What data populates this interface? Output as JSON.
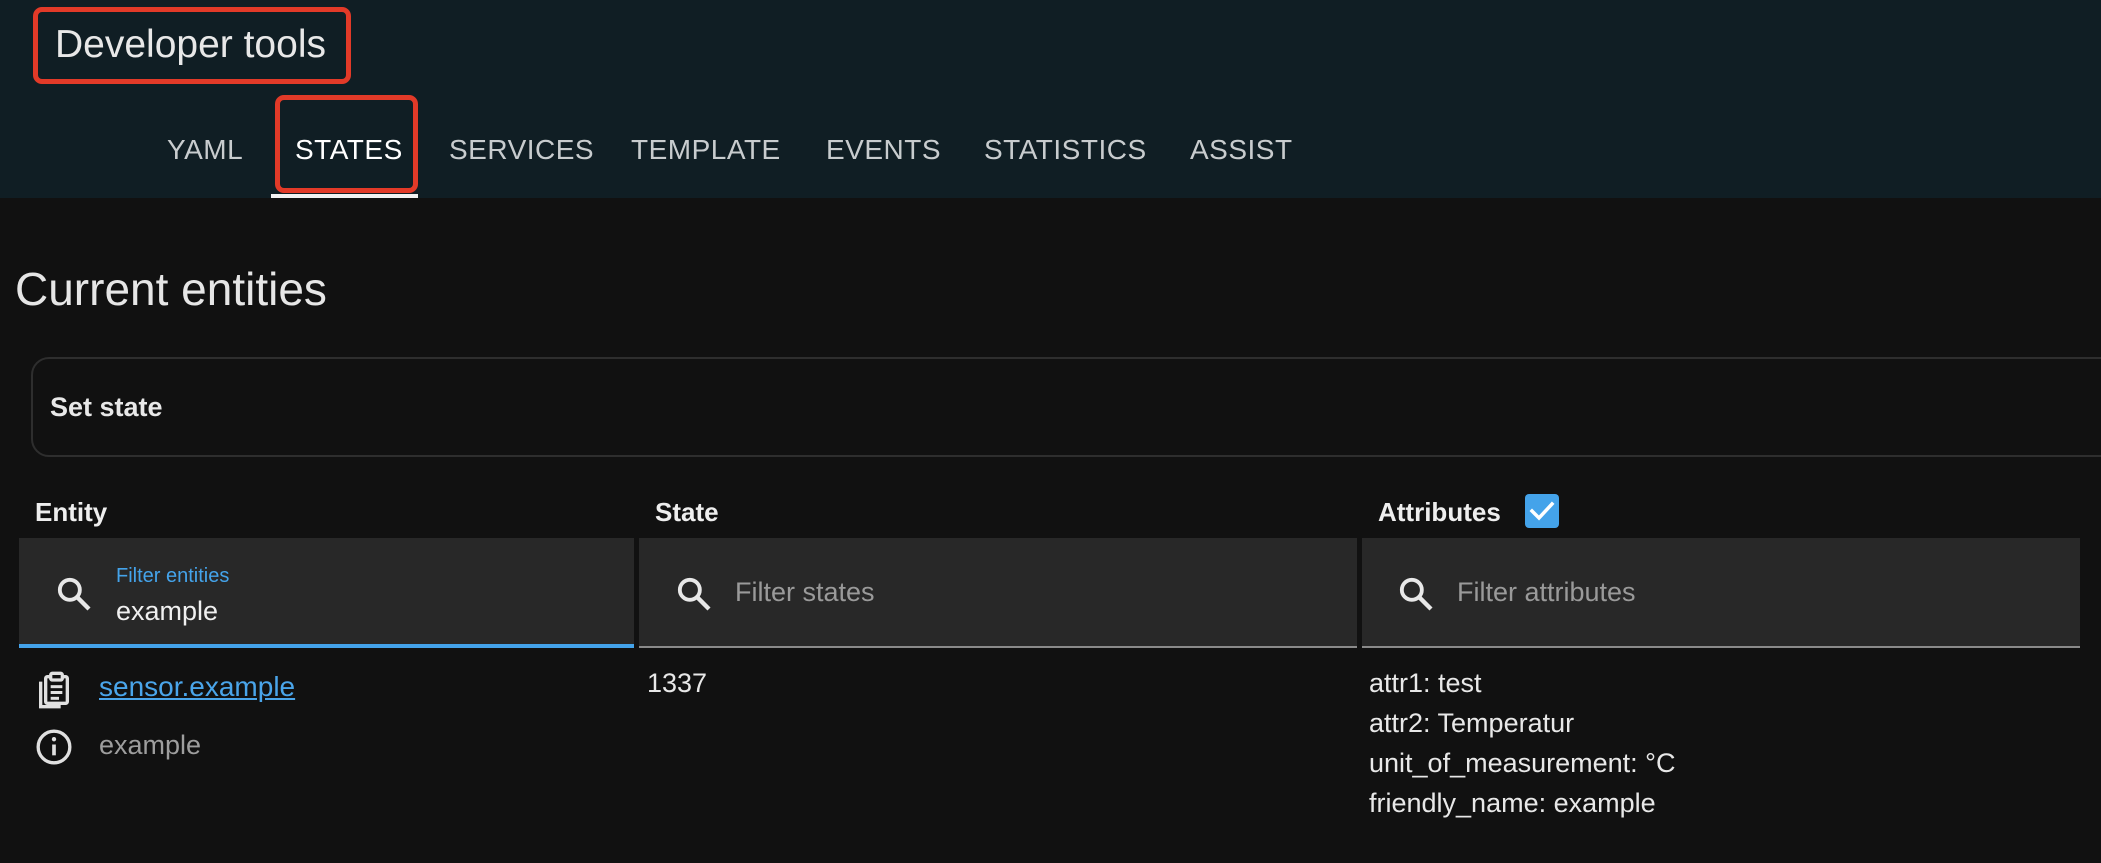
{
  "app": {
    "title": "Developer tools"
  },
  "tabs": [
    {
      "label": "YAML",
      "active": false
    },
    {
      "label": "STATES",
      "active": true
    },
    {
      "label": "SERVICES",
      "active": false
    },
    {
      "label": "TEMPLATE",
      "active": false
    },
    {
      "label": "EVENTS",
      "active": false
    },
    {
      "label": "STATISTICS",
      "active": false
    },
    {
      "label": "ASSIST",
      "active": false
    }
  ],
  "page": {
    "title": "Current entities",
    "set_state_label": "Set state"
  },
  "table": {
    "columns": {
      "entity": "Entity",
      "state": "State",
      "attributes": "Attributes"
    },
    "attributes_checkbox_checked": true,
    "filters": {
      "entity": {
        "label": "Filter entities",
        "value": "example"
      },
      "state": {
        "placeholder": "Filter states",
        "value": ""
      },
      "attributes": {
        "placeholder": "Filter attributes",
        "value": ""
      }
    },
    "rows": [
      {
        "entity_id": "sensor.example",
        "friendly_name": "example",
        "state": "1337",
        "attributes": [
          "attr1: test",
          "attr2: Temperatur",
          "unit_of_measurement: °C",
          "friendly_name: example"
        ]
      }
    ]
  },
  "colors": {
    "header_bg": "#101e24",
    "page_bg": "#111111",
    "accent": "#44a3ea",
    "highlight_box": "#e23a28"
  },
  "icons": {
    "search": "search-icon",
    "copy": "clipboard-icon",
    "info": "info-icon",
    "check": "checkmark-icon"
  }
}
